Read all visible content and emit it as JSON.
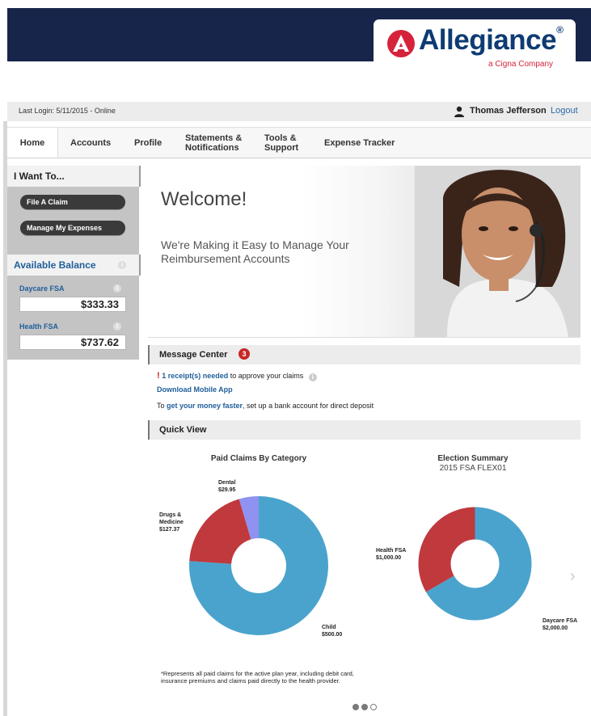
{
  "brand": {
    "name": "Allegiance",
    "sub": "a Cigna Company",
    "reg": "®"
  },
  "login": {
    "last_login": "Last Login: 5/11/2015 - Online",
    "user": "Thomas Jefferson",
    "logout": "Logout"
  },
  "nav": [
    {
      "label": "Home"
    },
    {
      "label": "Accounts"
    },
    {
      "label": "Profile"
    },
    {
      "label": "Statements & Notifications"
    },
    {
      "label": "Tools & Support"
    },
    {
      "label": "Expense Tracker"
    }
  ],
  "sidebar": {
    "iwant": "I Want To...",
    "file_claim": "File A Claim",
    "manage": "Manage My Expenses",
    "balance_title": "Available Balance",
    "accounts": [
      {
        "label": "Daycare FSA",
        "value": "$333.33"
      },
      {
        "label": "Health FSA",
        "value": "$737.62"
      }
    ]
  },
  "hero": {
    "title": "Welcome!",
    "subtitle": "We're Making it Easy to Manage Your Reimbursement Accounts"
  },
  "message_center": {
    "title": "Message Center",
    "count": "3",
    "line1_mark": "!",
    "line1_link": "1 receipt(s) needed",
    "line1_rest": " to approve your claims",
    "line2_link": "Download Mobile App",
    "line3_pre": "To ",
    "line3_link": "get your money faster",
    "line3_rest": ", set up a bank account for direct deposit"
  },
  "quick_view": {
    "title": "Quick View"
  },
  "colors": {
    "blue": "#4aa3cc",
    "red": "#c0393d",
    "lavender": "#8f92f0",
    "navy": "#17254a"
  },
  "chart_data": [
    {
      "type": "pie",
      "title": "Paid Claims By Category",
      "slices": [
        {
          "name": "Child",
          "value": 500.0,
          "label": "Child",
          "amount": "$500.00"
        },
        {
          "name": "Drugs & Medicine",
          "value": 127.37,
          "label": "Drugs & Medicine",
          "amount": "$127.37"
        },
        {
          "name": "Dental",
          "value": 29.95,
          "label": "Dental",
          "amount": "$29.95"
        }
      ]
    },
    {
      "type": "pie",
      "title": "Election Summary",
      "subtitle": "2015 FSA FLEX01",
      "slices": [
        {
          "name": "Daycare FSA",
          "value": 2000.0,
          "label": "Daycare FSA",
          "amount": "$2,000.00"
        },
        {
          "name": "Health FSA",
          "value": 1000.0,
          "label": "Health FSA",
          "amount": "$1,000.00"
        }
      ]
    }
  ],
  "footnote": "*Represents all paid claims for the active plan year, including debit card, insurance premiums and claims paid directly to the health provider."
}
